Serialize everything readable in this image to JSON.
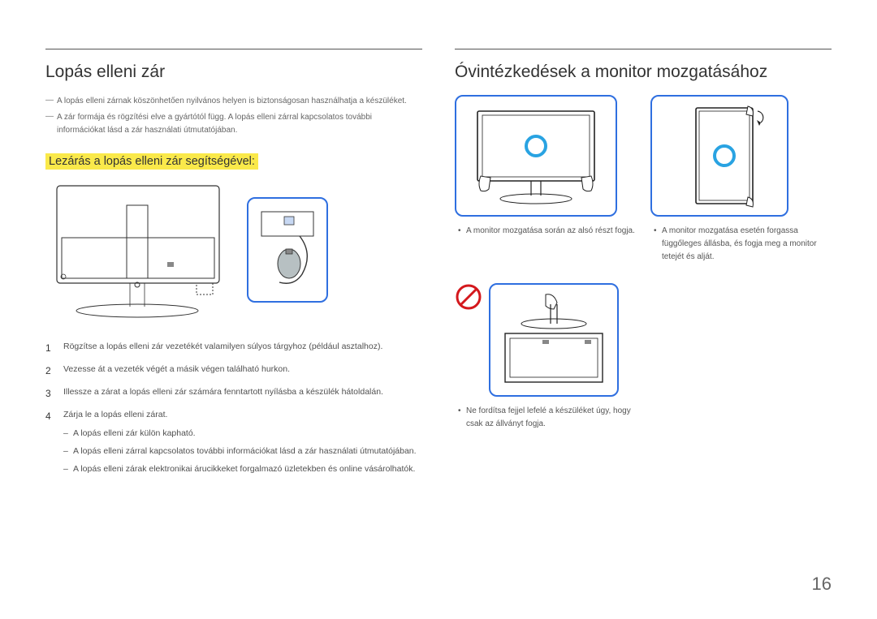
{
  "left": {
    "heading": "Lopás elleni zár",
    "notes": [
      "A lopás elleni zárnak köszönhetően nyilvános helyen is biztonságosan használhatja a készüléket.",
      "A zár formája és rögzítési elve a gyártótól függ. A lopás elleni zárral kapcsolatos további információkat lásd a zár használati útmutatójában."
    ],
    "subheading": "Lezárás a lopás elleni zár segítségével:",
    "steps": [
      "Rögzítse a lopás elleni zár vezetékét valamilyen súlyos tárgyhoz (például asztalhoz).",
      "Vezesse át a vezeték végét a másik végen található hurkon.",
      "Illessze a zárat a lopás elleni zár számára fenntartott nyílásba a készülék hátoldalán.",
      "Zárja le a lopás elleni zárat."
    ],
    "substeps": [
      "A lopás elleni zár külön kapható.",
      "A lopás elleni zárral kapcsolatos további információkat lásd a zár használati útmutatójában.",
      "A lopás elleni zárak elektronikai árucikkeket forgalmazó üzletekben és online vásárolhatók."
    ]
  },
  "right": {
    "heading": "Óvintézkedések a monitor mozgatásához",
    "row1": [
      "A monitor mozgatása során az alsó részt fogja.",
      "A monitor mozgatása esetén forgassa függőleges állásba, és fogja meg a monitor tetejét és alját."
    ],
    "row2": [
      "Ne fordítsa fejjel lefelé a készüléket úgy, hogy csak az állványt fogja."
    ]
  },
  "page_number": "16"
}
